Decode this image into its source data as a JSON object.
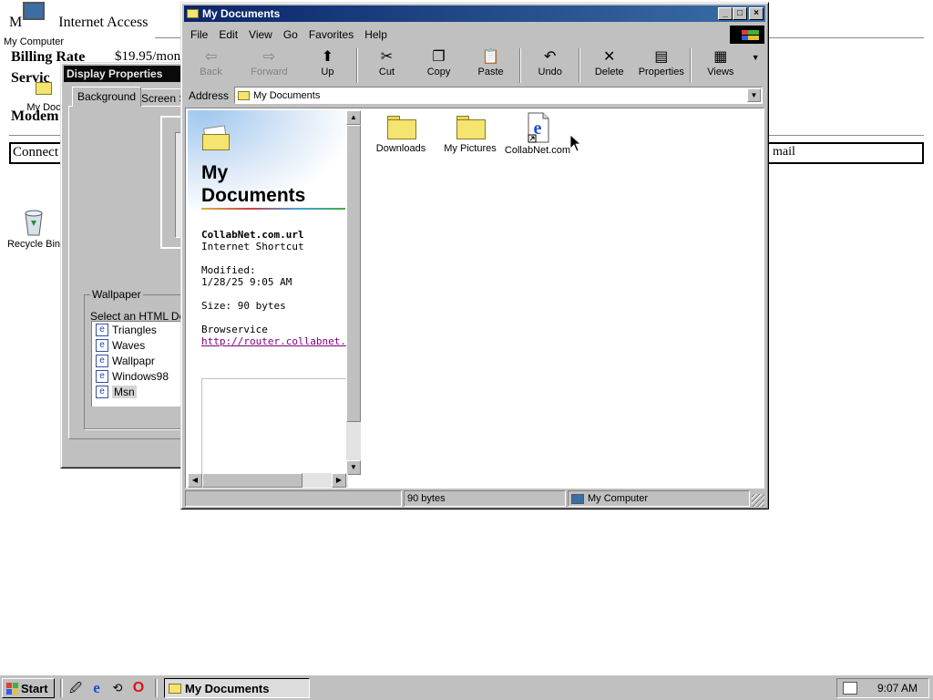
{
  "desktop": {
    "heading": "Internet Access",
    "heading_prefix": "M",
    "my_computer_label": "My Computer",
    "billing_rate_label": "Billing Rate",
    "billing_rate_value": "$19.95/mon",
    "service_label": "Servic",
    "modem_label": "Modem",
    "my_docs_partial": "My Doc",
    "connect_label": "Connect",
    "mail_label": "mail",
    "recycle_bin_label": "Recycle Bin"
  },
  "display_properties": {
    "title": "Display Properties",
    "tabs": [
      "Background",
      "Screen S"
    ],
    "wallpaper_group": "Wallpaper",
    "select_label": "Select an HTML Doc",
    "wallpapers": [
      "Triangles",
      "Waves",
      "Wallpapr",
      "Windows98",
      "Msn"
    ],
    "selected_wallpaper": "Msn"
  },
  "explorer": {
    "title": "My Documents",
    "menu": [
      "File",
      "Edit",
      "View",
      "Go",
      "Favorites",
      "Help"
    ],
    "toolbar": [
      {
        "label": "Back",
        "icon": "back-arrow-icon",
        "enabled": false
      },
      {
        "label": "Forward",
        "icon": "forward-arrow-icon",
        "enabled": false
      },
      {
        "label": "Up",
        "icon": "up-folder-icon",
        "enabled": true
      },
      {
        "label": "Cut",
        "icon": "scissors-icon",
        "enabled": true
      },
      {
        "label": "Copy",
        "icon": "copy-icon",
        "enabled": true
      },
      {
        "label": "Paste",
        "icon": "paste-icon",
        "enabled": true
      },
      {
        "label": "Undo",
        "icon": "undo-icon",
        "enabled": true
      },
      {
        "label": "Delete",
        "icon": "delete-x-icon",
        "enabled": true
      },
      {
        "label": "Properties",
        "icon": "properties-icon",
        "enabled": true
      },
      {
        "label": "Views",
        "icon": "views-icon",
        "enabled": true
      }
    ],
    "address_label": "Address",
    "address_value": "My Documents",
    "webview": {
      "title_line1": "My",
      "title_line2": "Documents",
      "file_name": "CollabNet.com.url",
      "file_type": "Internet Shortcut",
      "modified_label": "Modified:",
      "modified_value": "1/28/25 9:05 AM",
      "size_text": "Size: 90 bytes",
      "service_label": "Browservice",
      "link": "http://router.collabnet.local"
    },
    "files": [
      {
        "name": "Downloads",
        "type": "folder"
      },
      {
        "name": "My Pictures",
        "type": "folder"
      },
      {
        "name": "CollabNet.com",
        "type": "internet-shortcut"
      }
    ],
    "status_size": "90 bytes",
    "status_zone": "My Computer"
  },
  "taskbar": {
    "start_label": "Start",
    "task_label": "My Documents",
    "clock": "9:07 AM"
  },
  "colors": {
    "title_active": "#0a246a",
    "title_inactive": "#808080",
    "face": "#c0c0c0",
    "link": "#800080"
  }
}
